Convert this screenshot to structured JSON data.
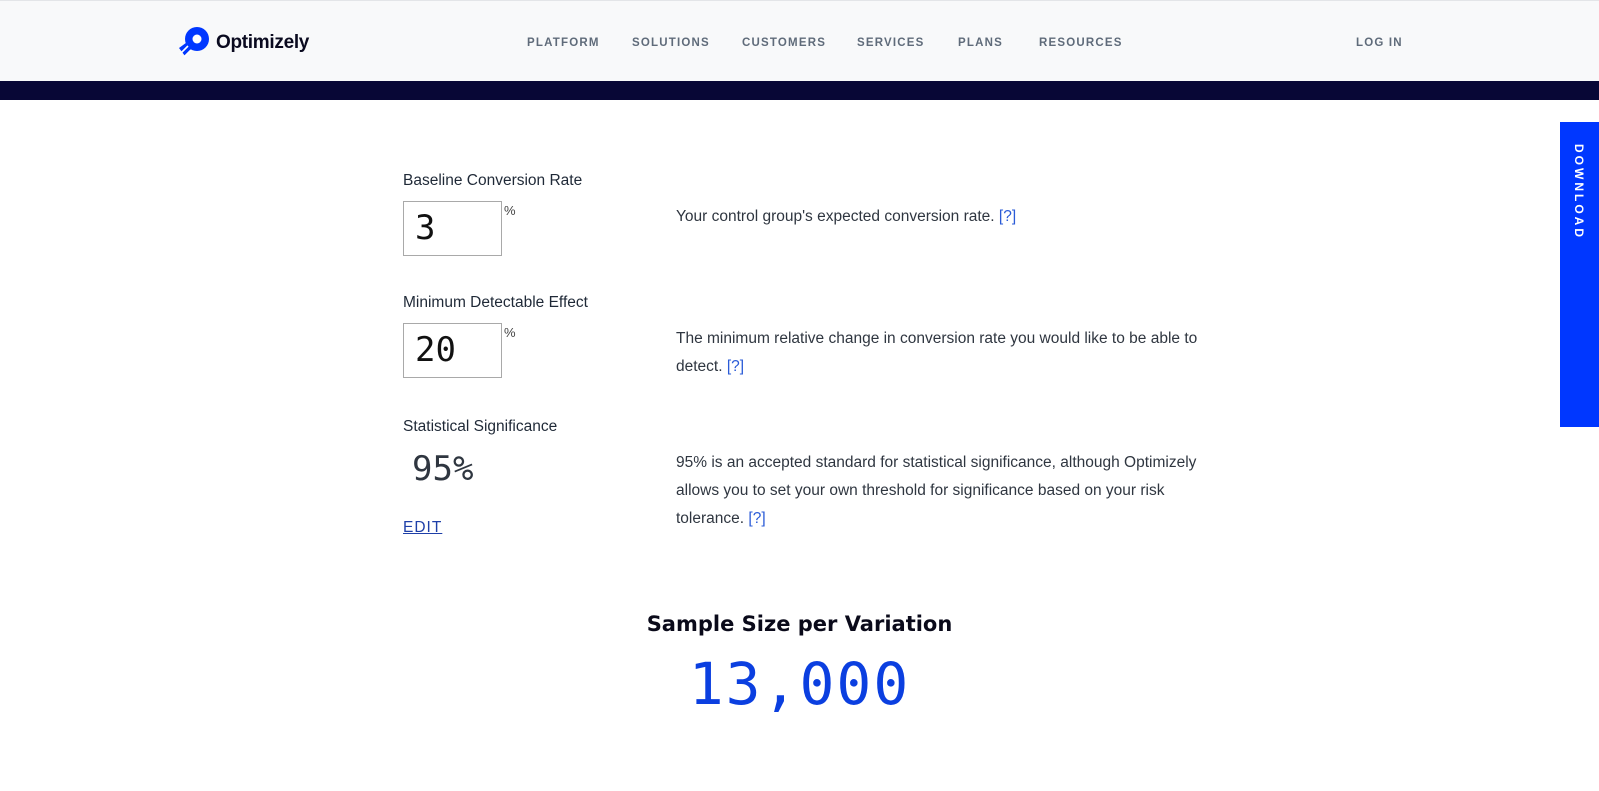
{
  "header": {
    "brand": "Optimizely",
    "nav": [
      "PLATFORM",
      "SOLUTIONS",
      "CUSTOMERS",
      "SERVICES",
      "PLANS",
      "RESOURCES"
    ],
    "login": "LOG IN",
    "brand_color": "#0037ff",
    "band_color": "#080736"
  },
  "form": {
    "baseline": {
      "label": "Baseline Conversion Rate",
      "value": "3",
      "unit": "%",
      "description": "Your control group's expected conversion rate.",
      "help": "[?]"
    },
    "mde": {
      "label": "Minimum Detectable Effect",
      "value": "20",
      "unit": "%",
      "description": "The minimum relative change in conversion rate you would like to be able to detect.",
      "help": "[?]"
    },
    "significance": {
      "label": "Statistical Significance",
      "value": "95%",
      "edit": "EDIT",
      "description": "95% is an accepted standard for statistical significance, although Optimizely allows you to set your own threshold for significance based on your risk tolerance.",
      "help": "[?]"
    }
  },
  "result": {
    "title": "Sample Size per Variation",
    "value": "13,000"
  },
  "side_tab": {
    "label": "DOWNLOAD"
  }
}
